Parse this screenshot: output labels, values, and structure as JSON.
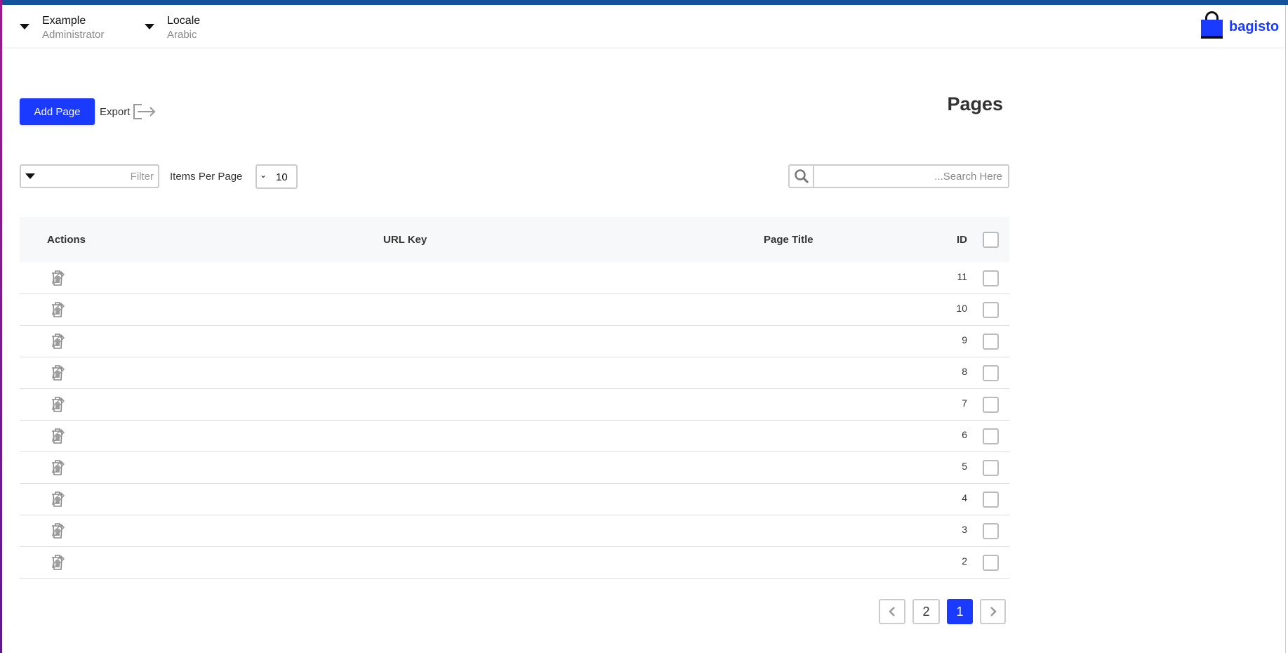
{
  "header": {
    "user": {
      "name": "Example",
      "role": "Administrator"
    },
    "locale": {
      "label": "Locale",
      "value": "Arabic"
    },
    "logo": "bagisto"
  },
  "toolbar": {
    "add_label": "Add Page",
    "export_label": "Export",
    "title": "Pages"
  },
  "filters": {
    "filter_placeholder": "Filter",
    "items_per_page_label": "Items Per Page",
    "items_per_page": "10",
    "search_placeholder": "...Search Here"
  },
  "table": {
    "columns": [
      "Actions",
      "URL Key",
      "Page Title",
      "ID"
    ],
    "rows": [
      {
        "url_key": "",
        "page_title": "",
        "id": "11"
      },
      {
        "url_key": "",
        "page_title": "",
        "id": "10"
      },
      {
        "url_key": "",
        "page_title": "",
        "id": "9"
      },
      {
        "url_key": "",
        "page_title": "",
        "id": "8"
      },
      {
        "url_key": "",
        "page_title": "",
        "id": "7"
      },
      {
        "url_key": "",
        "page_title": "",
        "id": "6"
      },
      {
        "url_key": "",
        "page_title": "",
        "id": "5"
      },
      {
        "url_key": "",
        "page_title": "",
        "id": "4"
      },
      {
        "url_key": "",
        "page_title": "",
        "id": "3"
      },
      {
        "url_key": "",
        "page_title": "",
        "id": "2"
      }
    ]
  },
  "pagination": {
    "pages": [
      "2",
      "1"
    ],
    "current": "1"
  },
  "colors": {
    "brand": "#1a3aff",
    "topbar": "#14529a"
  }
}
